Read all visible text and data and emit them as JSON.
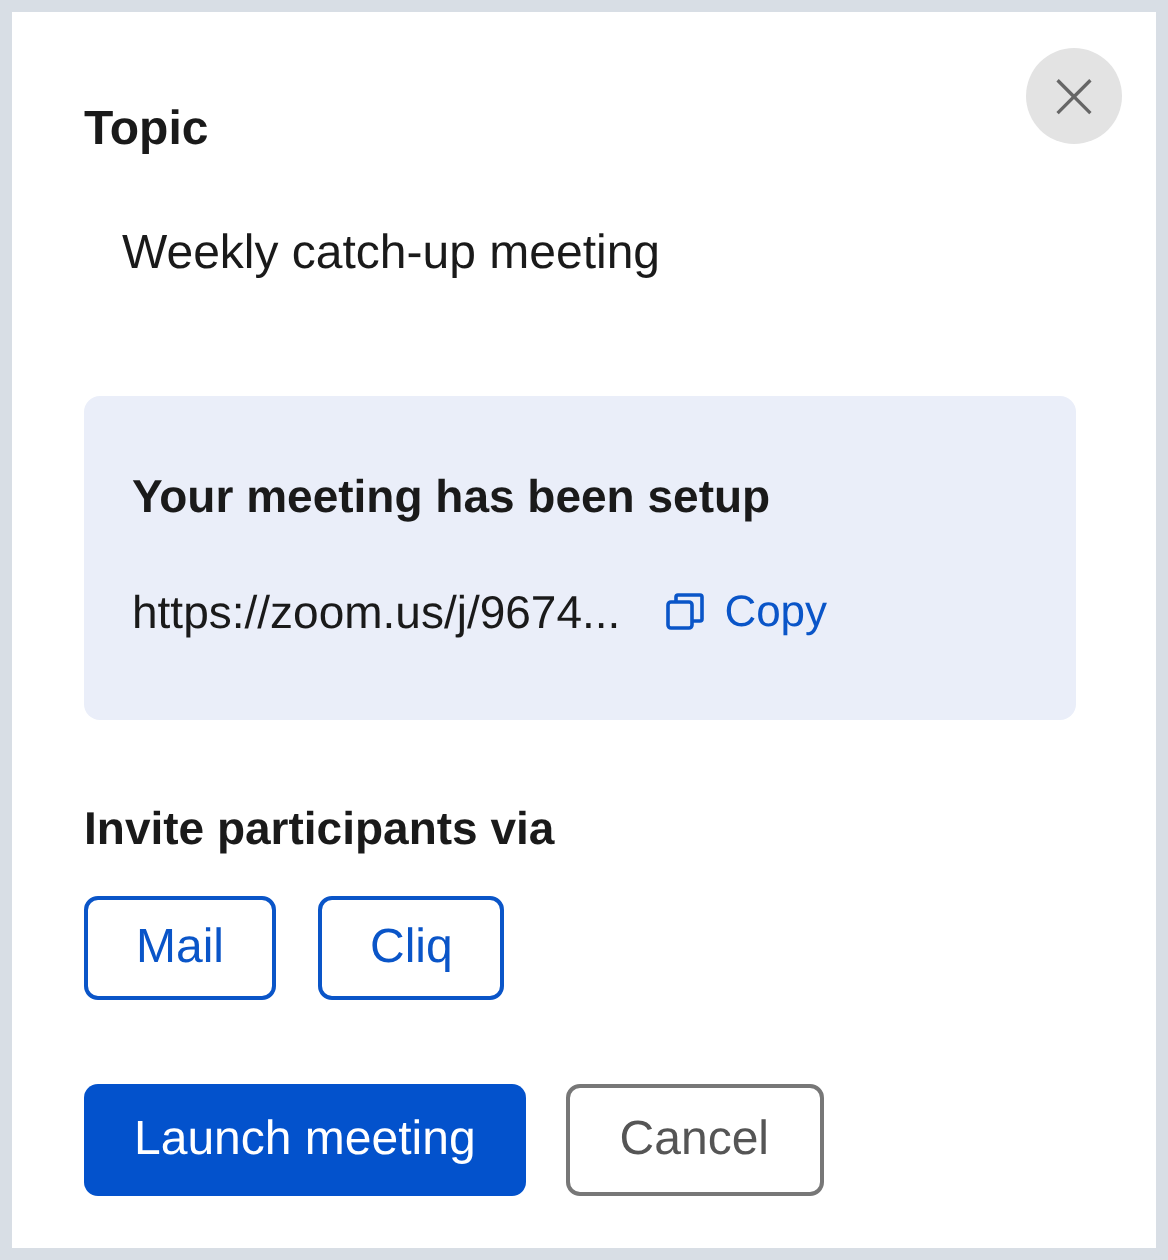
{
  "dialog": {
    "close_label": "×",
    "topic_label": "Topic",
    "topic_value": "Weekly catch-up meeting"
  },
  "setup_notice": {
    "title": "Your meeting has been setup",
    "link": "https://zoom.us/j/9674...",
    "copy_label": "Copy"
  },
  "invite": {
    "label": "Invite participants via",
    "options": [
      {
        "label": "Mail"
      },
      {
        "label": "Cliq"
      }
    ]
  },
  "actions": [
    {
      "label": "Launch meeting",
      "kind": "primary"
    },
    {
      "label": "Cancel",
      "kind": "secondary"
    }
  ]
}
